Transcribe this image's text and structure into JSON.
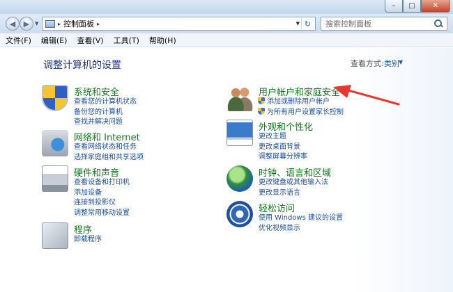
{
  "window": {
    "minimize": "–",
    "maximize": "□",
    "close": "✕"
  },
  "address": {
    "back": "◀",
    "forward": "▶",
    "history_dropdown": "▼",
    "separator": "▸",
    "location": "控制面板",
    "location_arrow": "▸",
    "dropdown": "▼",
    "refresh": "↻"
  },
  "search": {
    "placeholder": "搜索控制面板"
  },
  "menu": [
    "文件(F)",
    "编辑(E)",
    "查看(V)",
    "工具(T)",
    "帮助(H)"
  ],
  "main": {
    "heading": "调整计算机的设置",
    "view_by_label": "查看方式:",
    "view_by_value": "类别",
    "view_by_dropdown": "▼"
  },
  "categories": [
    {
      "title": "系统和安全",
      "icon": "shield-icon",
      "links": [
        "查看您的计算机状态",
        "备份您的计算机",
        "查找并解决问题"
      ]
    },
    {
      "title": "网络和 Internet",
      "icon": "network-icon",
      "links": [
        "查看网络状态和任务",
        "选择家庭组和共享选项"
      ]
    },
    {
      "title": "硬件和声音",
      "icon": "printer-icon",
      "links": [
        "查看设备和打印机",
        "添加设备",
        "连接到投影仪",
        "调整常用移动设置"
      ]
    },
    {
      "title": "程序",
      "icon": "programs-icon",
      "links": [
        "卸载程序"
      ]
    },
    {
      "title": "用户帐户和家庭安全",
      "icon": "users-icon",
      "links": [
        "添加或删除用户帐户",
        "为所有用户设置家长控制"
      ]
    },
    {
      "title": "外观和个性化",
      "icon": "display-icon",
      "links": [
        "更改主题",
        "更改桌面背景",
        "调整屏幕分辨率"
      ]
    },
    {
      "title": "时钟、语言和区域",
      "icon": "globe-icon",
      "links": [
        "更改键盘或其他输入法",
        "更改显示语言"
      ]
    },
    {
      "title": "轻松访问",
      "icon": "ease-of-access-icon",
      "links": [
        "使用 Windows 建议的设置",
        "优化视频显示"
      ]
    }
  ],
  "annotation": {
    "color": "#e8382d"
  }
}
